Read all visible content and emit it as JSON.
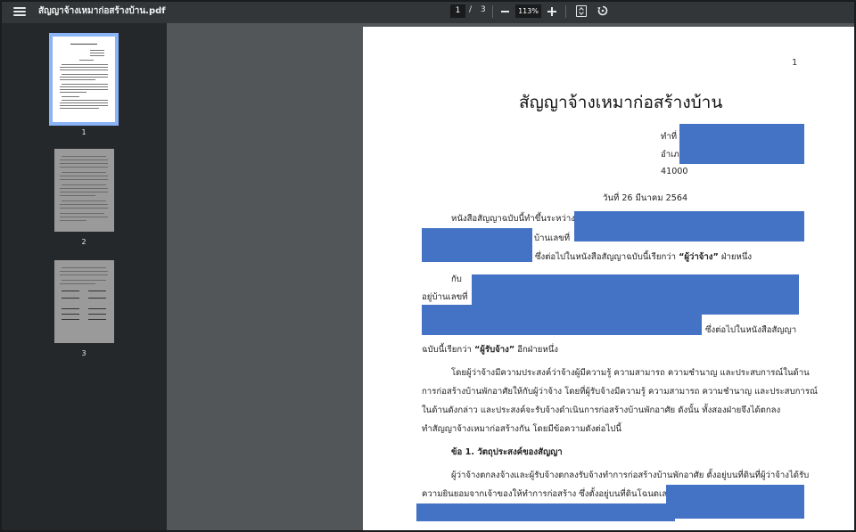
{
  "toolbar": {
    "file_title": "สัญญาจ้างเหมาก่อสร้างบ้าน.pdf",
    "current_page": "1",
    "separator": "/",
    "total_pages": "3",
    "zoom_level": "113%"
  },
  "sidebar": {
    "thumbnails": [
      {
        "label": "1",
        "selected": true
      },
      {
        "label": "2",
        "selected": false
      },
      {
        "label": "3",
        "selected": false
      }
    ]
  },
  "document": {
    "page_number": "1",
    "title": "สัญญาจ้างเหมาก่อสร้างบ้าน",
    "addr_line1": "ทำที่",
    "addr_line2": "อำเภ",
    "addr_line3": "41000",
    "date_line": "วันที่ 26 มีนาคม 2564",
    "p1_line1": "หนังสือสัญญาฉบับนี้ทำขึ้นระหว่าง",
    "p1_line2": "บ้านเลขที่",
    "p1_line3_a": "ซึ่งต่อไปในหนังสือสัญญาฉบับนี้เรียกว่า",
    "p1_line3_b": "“ผู้ว่าจ้าง”",
    "p1_line3_c": "ฝ่ายหนึ่ง",
    "p2_line1": "กับ",
    "p2_line2": "อยู่บ้านเลขที่",
    "p2_line3": "ซึ่งต่อไปในหนังสือสัญญา",
    "p2_line4_a": "ฉบับนี้เรียกว่า",
    "p2_line4_b": "“ผู้รับจ้าง”",
    "p2_line4_c": "อีกฝ่ายหนึ่ง",
    "p3_line1": "โดยผู้ว่าจ้างมีความประสงค์ว่าจ้างผู้มีความรู้ ความสามารถ ความชำนาญ และประสบการณ์ในด้าน",
    "p3_line2": "การก่อสร้างบ้านพักอาศัยให้กับผู้ว่าจ้าง โดยที่ผู้รับจ้างมีความรู้ ความสามารถ ความชำนาญ และประสบการณ์",
    "p3_line3": "ในด้านดังกล่าว และประสงค์จะรับจ้างดำเนินการก่อสร้างบ้านพักอาศัย  ดังนั้น ทั้งสองฝ่ายจึงได้ตกลง",
    "p3_line4": "ทำสัญญาจ้างเหมาก่อสร้างกัน โดยมีข้อความดังต่อไปนี้",
    "section1_heading": "ข้อ 1. วัตถุประสงค์ของสัญญา",
    "s1_line1": "ผู้ว่าจ้างตกลงจ้างและผู้รับจ้างตกลงรับจ้างทำการก่อสร้างบ้านพักอาศัย ตั้งอยู่บนที่ดินที่ผู้ว่าจ้างได้รับ",
    "s1_line2": "ความยินยอมจากเจ้าของให้ทำการก่อสร้าง ซึ่งตั้งอยู่บนที่ดินโฉนดเลขที่"
  }
}
